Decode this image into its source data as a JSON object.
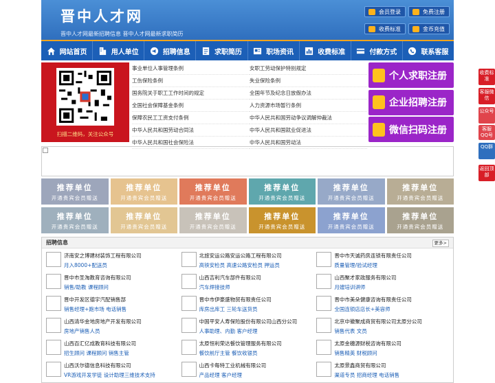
{
  "header": {
    "logo": "晋中人才网",
    "tagline": "晋中人才网最新招聘信息   晋中人才网最新求职简历",
    "buttons": [
      "会员登录",
      "免费注册",
      "收费标准",
      "金币充值"
    ]
  },
  "nav": [
    {
      "label": "网站首页",
      "icon": "home-icon"
    },
    {
      "label": "用人单位",
      "icon": "building-icon"
    },
    {
      "label": "招聘信息",
      "icon": "megaphone-icon"
    },
    {
      "label": "求职简历",
      "icon": "resume-icon"
    },
    {
      "label": "职场资讯",
      "icon": "news-icon"
    },
    {
      "label": "收费标准",
      "icon": "chart-icon"
    },
    {
      "label": "付款方式",
      "icon": "card-icon"
    },
    {
      "label": "联系客服",
      "icon": "phone-icon"
    }
  ],
  "qr_caption": "扫描二维码，关注公众号",
  "policy_links": [
    "事业单位人事管理条例",
    "女职工劳动保护特别规定",
    "工伤保险条例",
    "失业保险条例",
    "国务院关于职工工作时间的规定",
    "全国年节及纪念日放假办法",
    "全国社会保障基金条例",
    "人力资源市场暂行条例",
    "保障农民工工资支付条例",
    "中华人民共和国劳动争议调解仲裁法",
    "中华人民共和国劳动合同法",
    "中华人民共和国就业促进法",
    "中华人民共和国社会保险法",
    "中华人民共和国劳动法"
  ],
  "register": [
    "个人求职注册",
    "企业招聘注册",
    "微信扫码注册"
  ],
  "tiles": {
    "title": "推荐单位",
    "subtitle": "开通贵宾会员赠送",
    "colors": [
      "#9da6bb",
      "#e6c38f",
      "#e07a5b",
      "#5fa7ad",
      "#97a9c8",
      "#b8ad95",
      "#9fb0bd",
      "#e2c693",
      "#c8c2b9",
      "#c9932d",
      "#8ca2cf",
      "#a9a28f"
    ]
  },
  "jobs_section": {
    "title": "招聘信息",
    "more": "更多>",
    "items": [
      {
        "company": "济南安之博建材装饰工程有限公司",
        "positions": "月入8000+配送员"
      },
      {
        "company": "北旅安运公路安运公路工程有限公司",
        "positions": "高铁安检员 高速公路安检员 押运员"
      },
      {
        "company": "晋中市天诚药房连锁有限责任公司",
        "positions": "质量管理/验试经理"
      },
      {
        "company": "晋中市圣淘教育咨询有限公司",
        "positions": "销售/助教 课程顾问"
      },
      {
        "company": "山西吉利汽车部件有限公司",
        "positions": "汽车焊接技师"
      },
      {
        "company": "山西聚才家政服务有限公司",
        "positions": "月嫂培训讲师"
      },
      {
        "company": "晋中开发区德宇汽配销售部",
        "positions": "销售经理+跑市场 电话销售"
      },
      {
        "company": "晋中市伊豪盛物贸有限责任公司",
        "positions": "库房出库工 三轮车送货员"
      },
      {
        "company": "晋中市美朵健康咨询有限责任公司",
        "positions": "全国连锁店店长+美容师"
      },
      {
        "company": "山西清华金地房地产开发有限公司",
        "positions": "房地产销售人员"
      },
      {
        "company": "中国平安人寿保险股份有限公司山西分公司",
        "positions": "人事助理、内勤 客户经理"
      },
      {
        "company": "北京中徽聚成商贸有限公司太原分公司",
        "positions": "销售代表 文员"
      },
      {
        "company": "山西百汇亿成教育科技有限公司",
        "positions": "招生顾问 课程顾问 销售主管"
      },
      {
        "company": "太原恒利荣达餐饮管理服务有限公司",
        "positions": "餐饮前厅主管 餐饮收银员"
      },
      {
        "company": "太原金穗源财税咨询有限公司",
        "positions": "销售精英 财税顾问"
      },
      {
        "company": "山西沃尔德信息科技有限公司",
        "positions": "VR游戏开发学徒 设计助理三维技术支持"
      },
      {
        "company": "山西卡每特工业机械有限公司",
        "positions": "产品经理 客户经理"
      },
      {
        "company": "太原景鑫商贸有限公司",
        "positions": "渠道专员 招商经理 电话销售"
      }
    ]
  },
  "side_float": [
    "收费标准",
    "客服微信",
    "公众号",
    "客服QQ号",
    "QQ群",
    "返回顶部"
  ]
}
